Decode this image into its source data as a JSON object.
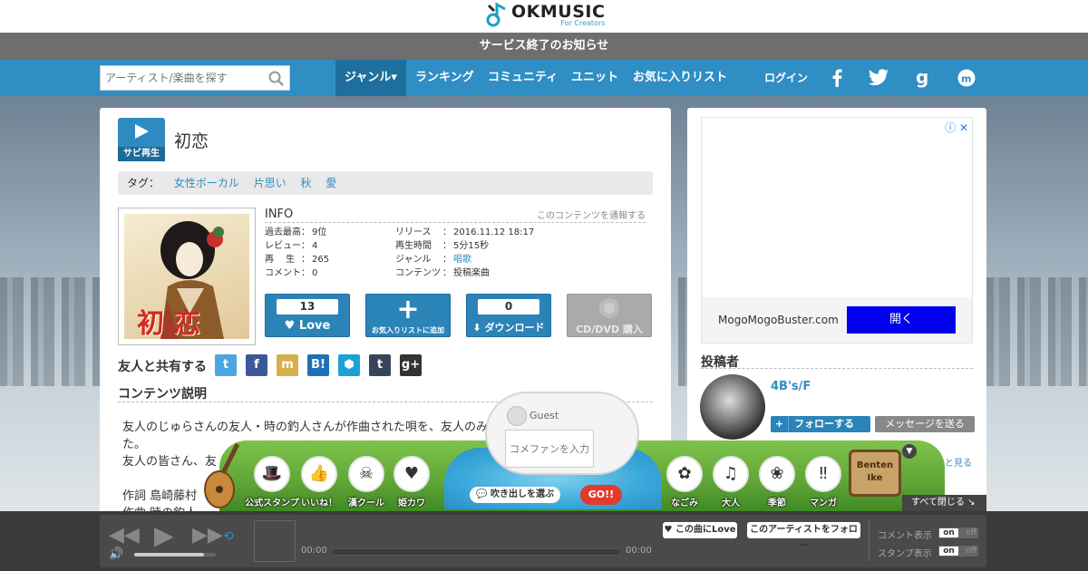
{
  "header": {
    "logo_text": "OKMUSIC",
    "logo_sub": "For Creators",
    "notice": "サービス終了のお知らせ"
  },
  "nav": {
    "search_placeholder": "アーティスト/楽曲を探す",
    "items": [
      "ジャンル▾",
      "ランキング",
      "コミュニティ",
      "ユニット",
      "お気に入りリスト"
    ],
    "login": "ログイン",
    "social_icons": [
      "facebook-icon",
      "twitter-icon",
      "google-icon",
      "mixi-icon"
    ]
  },
  "song": {
    "play_label": "サビ再生",
    "title": "初恋",
    "tag_label": "タグ：",
    "tags": [
      "女性ボーカル",
      "片思い",
      "秋",
      "愛"
    ],
    "jacket_text": "初恋",
    "info_heading": "INFO",
    "report_link": "このコンテンツを通報する",
    "info_left": [
      {
        "k": "過去最高",
        "v": "9位"
      },
      {
        "k": "レビュー",
        "v": "4"
      },
      {
        "k": "再　 生",
        "v": "265"
      },
      {
        "k": "コメント",
        "v": "0"
      }
    ],
    "info_right": [
      {
        "k": "リリース",
        "v": "2016.11.12 18:17"
      },
      {
        "k": "再生時間",
        "v": "5分15秒"
      },
      {
        "k": "ジャンル",
        "v": "唱歌"
      },
      {
        "k": "コンテンツ",
        "v": "投稿楽曲"
      }
    ],
    "love_count": "13",
    "love_label": "Love",
    "fav_label": "お気入りリストに追加",
    "dl_count": "0",
    "dl_label": "ダウンロード",
    "cd_label": "CD/DVD 購入",
    "share_heading": "友人と共有する",
    "desc_heading": "コンテンツ説明",
    "desc_lines": [
      "友人のじゅらさんの友人・時の釣人さんが作曲された唄を、友人のみんなで歌いまし",
      "た。",
      "友人の皆さん、友",
      "",
      "作詞 島崎藤村",
      "作曲 時の釣人"
    ]
  },
  "share_icons": [
    {
      "name": "twitter-share-icon",
      "glyph": "t",
      "color": "#4aa6e0"
    },
    {
      "name": "facebook-share-icon",
      "glyph": "f",
      "color": "#3b5998"
    },
    {
      "name": "mixi-share-icon",
      "glyph": "m",
      "color": "#d6b04a"
    },
    {
      "name": "hatena-share-icon",
      "glyph": "B!",
      "color": "#1f6fb5"
    },
    {
      "name": "evernote-share-icon",
      "glyph": "⬢",
      "color": "#1ba1d8"
    },
    {
      "name": "tumblr-share-icon",
      "glyph": "t",
      "color": "#35465c"
    },
    {
      "name": "googleplus-share-icon",
      "glyph": "g+",
      "color": "#333"
    }
  ],
  "ad": {
    "domain": "MogoMogoBuster.com",
    "open": "開く"
  },
  "poster": {
    "heading": "投稿者",
    "name": "4B's/F",
    "follow": "フォローする",
    "message": "メッセージを送る",
    "more": "もっと見る"
  },
  "stamps": {
    "left": [
      "公式スタンプ",
      "いいね！",
      "漢クール",
      "姫カワ"
    ],
    "right": [
      "なごみ",
      "大人",
      "季節",
      "マンガ"
    ],
    "guest": "Guest",
    "comment_placeholder": "コメファンを入力",
    "choose": "吹き出しを選ぶ",
    "go": "GO!!",
    "sign": "Benten Ike",
    "close_all": "すべて閉じる"
  },
  "player": {
    "time_start": "00:00",
    "time_end": "00:00",
    "volume_level": 0.85,
    "love_btn": "この曲にLove",
    "follow_btn": "このアーティストをフォロー",
    "comment_toggle": "コメント表示",
    "stamp_toggle": "スタンプ表示",
    "on": "on",
    "off": "off"
  },
  "colors": {
    "accent": "#2f8ec3",
    "notice_bg": "#6e6e6e",
    "ad_button": "#0000ee"
  }
}
